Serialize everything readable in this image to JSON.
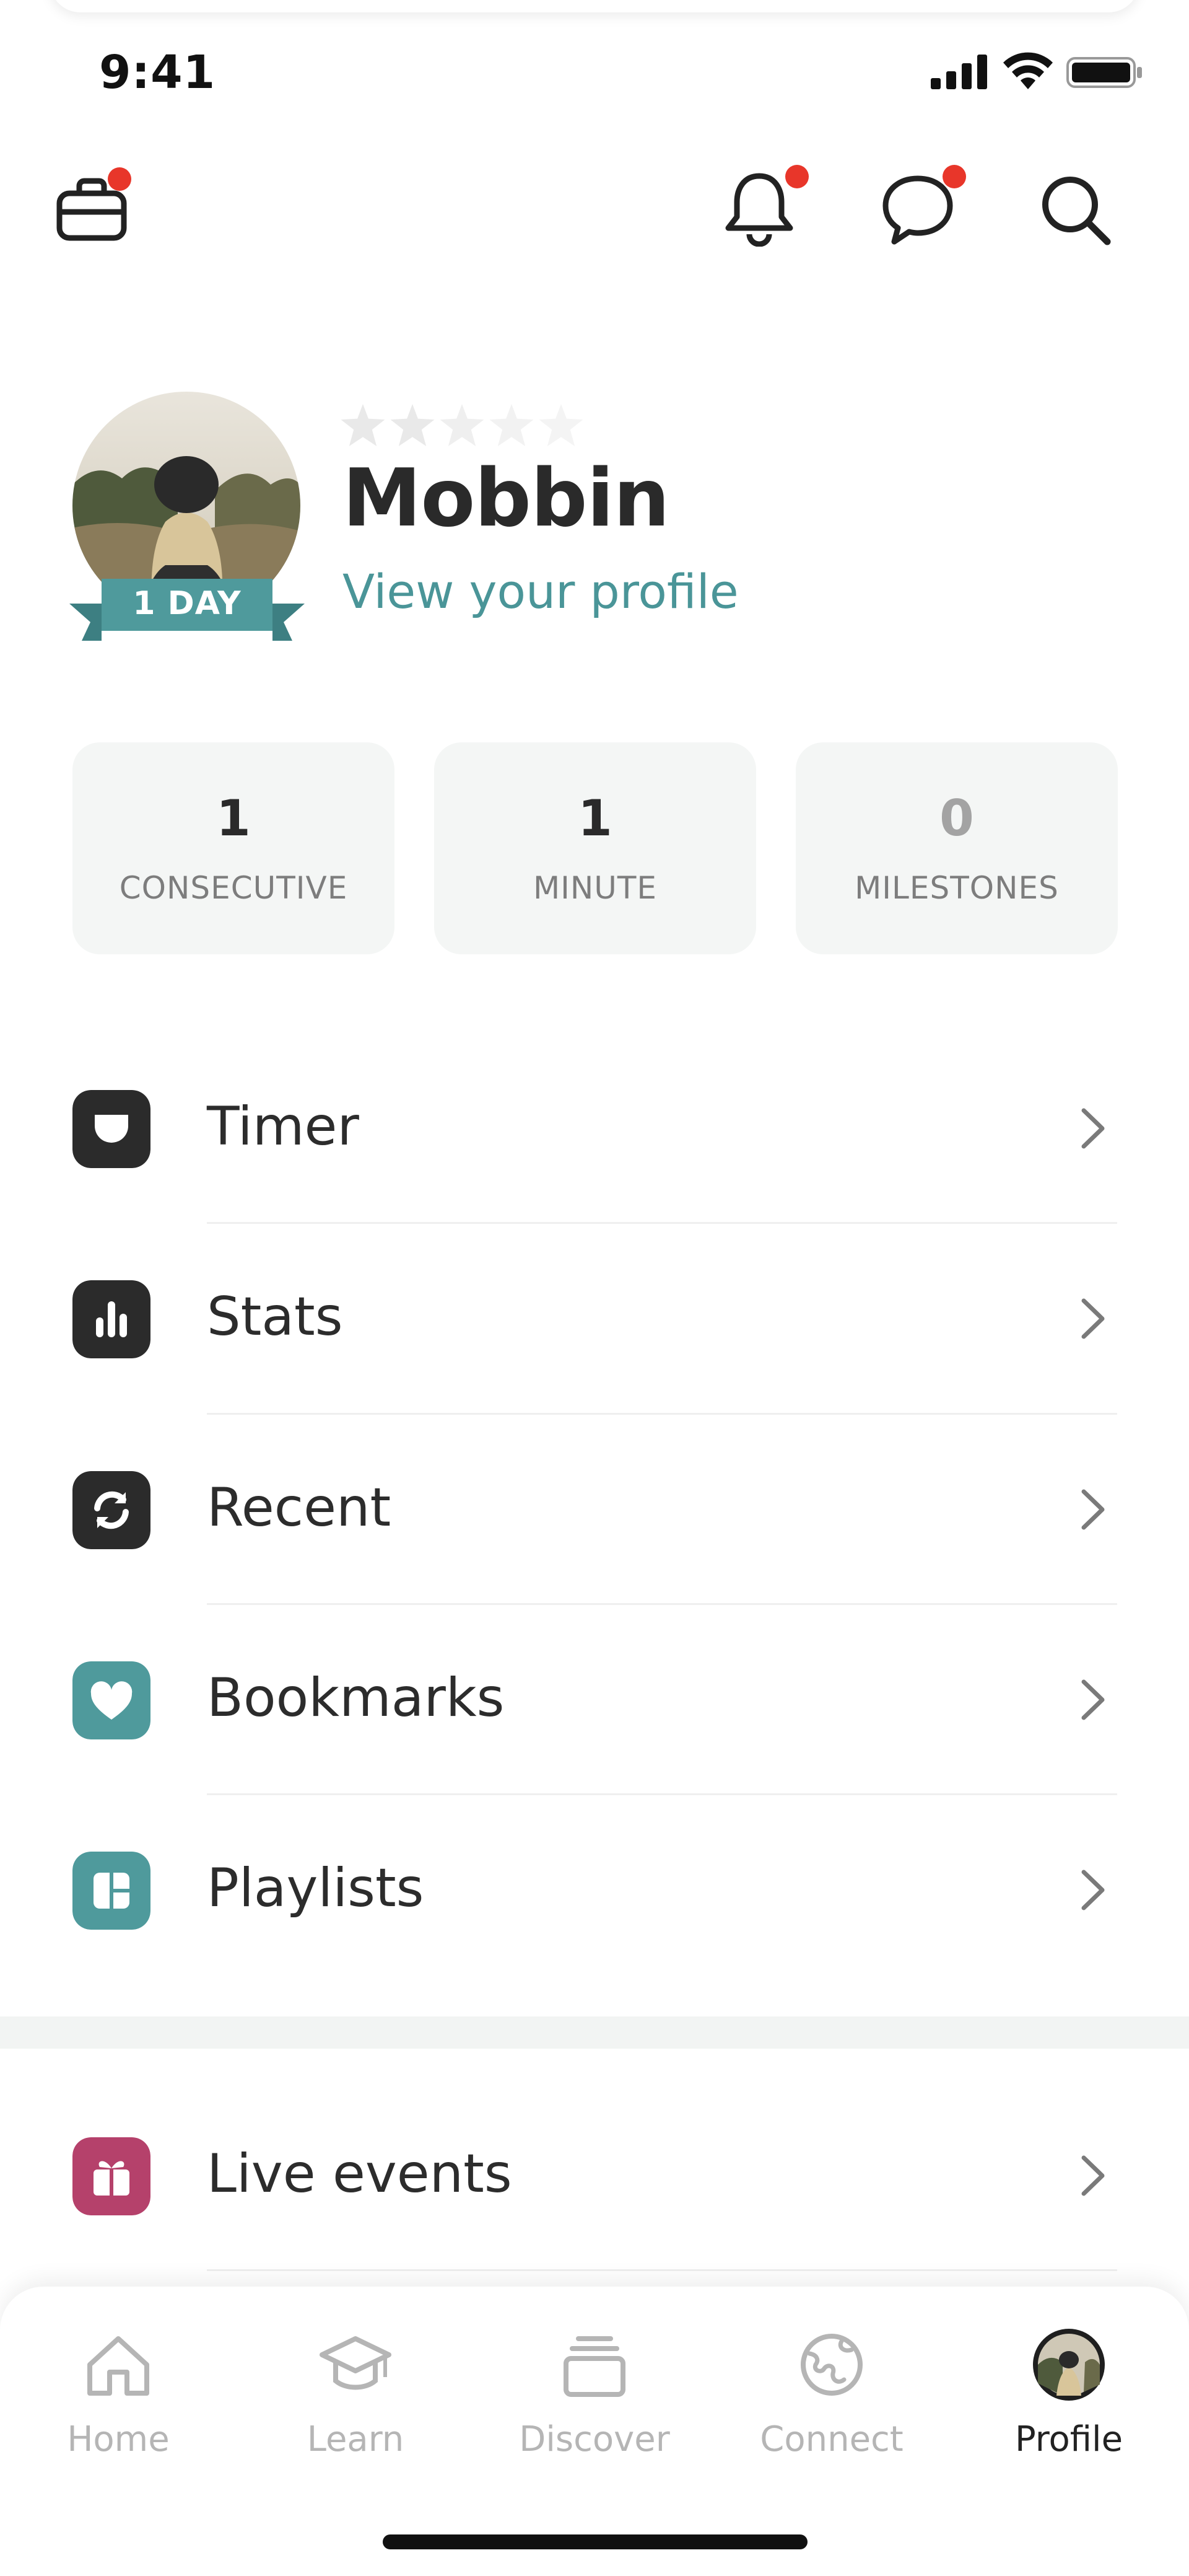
{
  "status_bar": {
    "time": "9:41"
  },
  "header": {
    "icons": [
      "briefcase-icon",
      "bell-icon",
      "chat-icon",
      "search-icon"
    ],
    "badge_color": "#e8362a"
  },
  "profile": {
    "name": "Mobbin",
    "link": "View your profile",
    "badge_label": "1 DAY",
    "rating_stars": 0,
    "rating_max": 5
  },
  "stats": [
    {
      "value": "1",
      "label": "CONSECUTIVE"
    },
    {
      "value": "1",
      "label": "MINUTE"
    },
    {
      "value": "0",
      "label": "MILESTONES"
    }
  ],
  "menu": [
    {
      "label": "Timer",
      "icon": "timer-icon",
      "color": "#2b2b2b"
    },
    {
      "label": "Stats",
      "icon": "bar-chart-icon",
      "color": "#2b2b2b"
    },
    {
      "label": "Recent",
      "icon": "refresh-icon",
      "color": "#2b2b2b"
    },
    {
      "label": "Bookmarks",
      "icon": "heart-icon",
      "color": "#4f9a9c"
    },
    {
      "label": "Playlists",
      "icon": "grid-icon",
      "color": "#4f9a9c"
    },
    {
      "label": "Live events",
      "icon": "gift-icon",
      "color": "#b5416b"
    }
  ],
  "tabs": [
    {
      "label": "Home",
      "icon": "home-icon"
    },
    {
      "label": "Learn",
      "icon": "graduation-cap-icon"
    },
    {
      "label": "Discover",
      "icon": "stack-icon"
    },
    {
      "label": "Connect",
      "icon": "globe-icon"
    },
    {
      "label": "Profile",
      "icon": "avatar-icon",
      "active": true
    }
  ],
  "colors": {
    "accent_teal": "#4a9598",
    "card_bg": "#f4f6f5",
    "tab_inactive": "#b5b5b5"
  }
}
